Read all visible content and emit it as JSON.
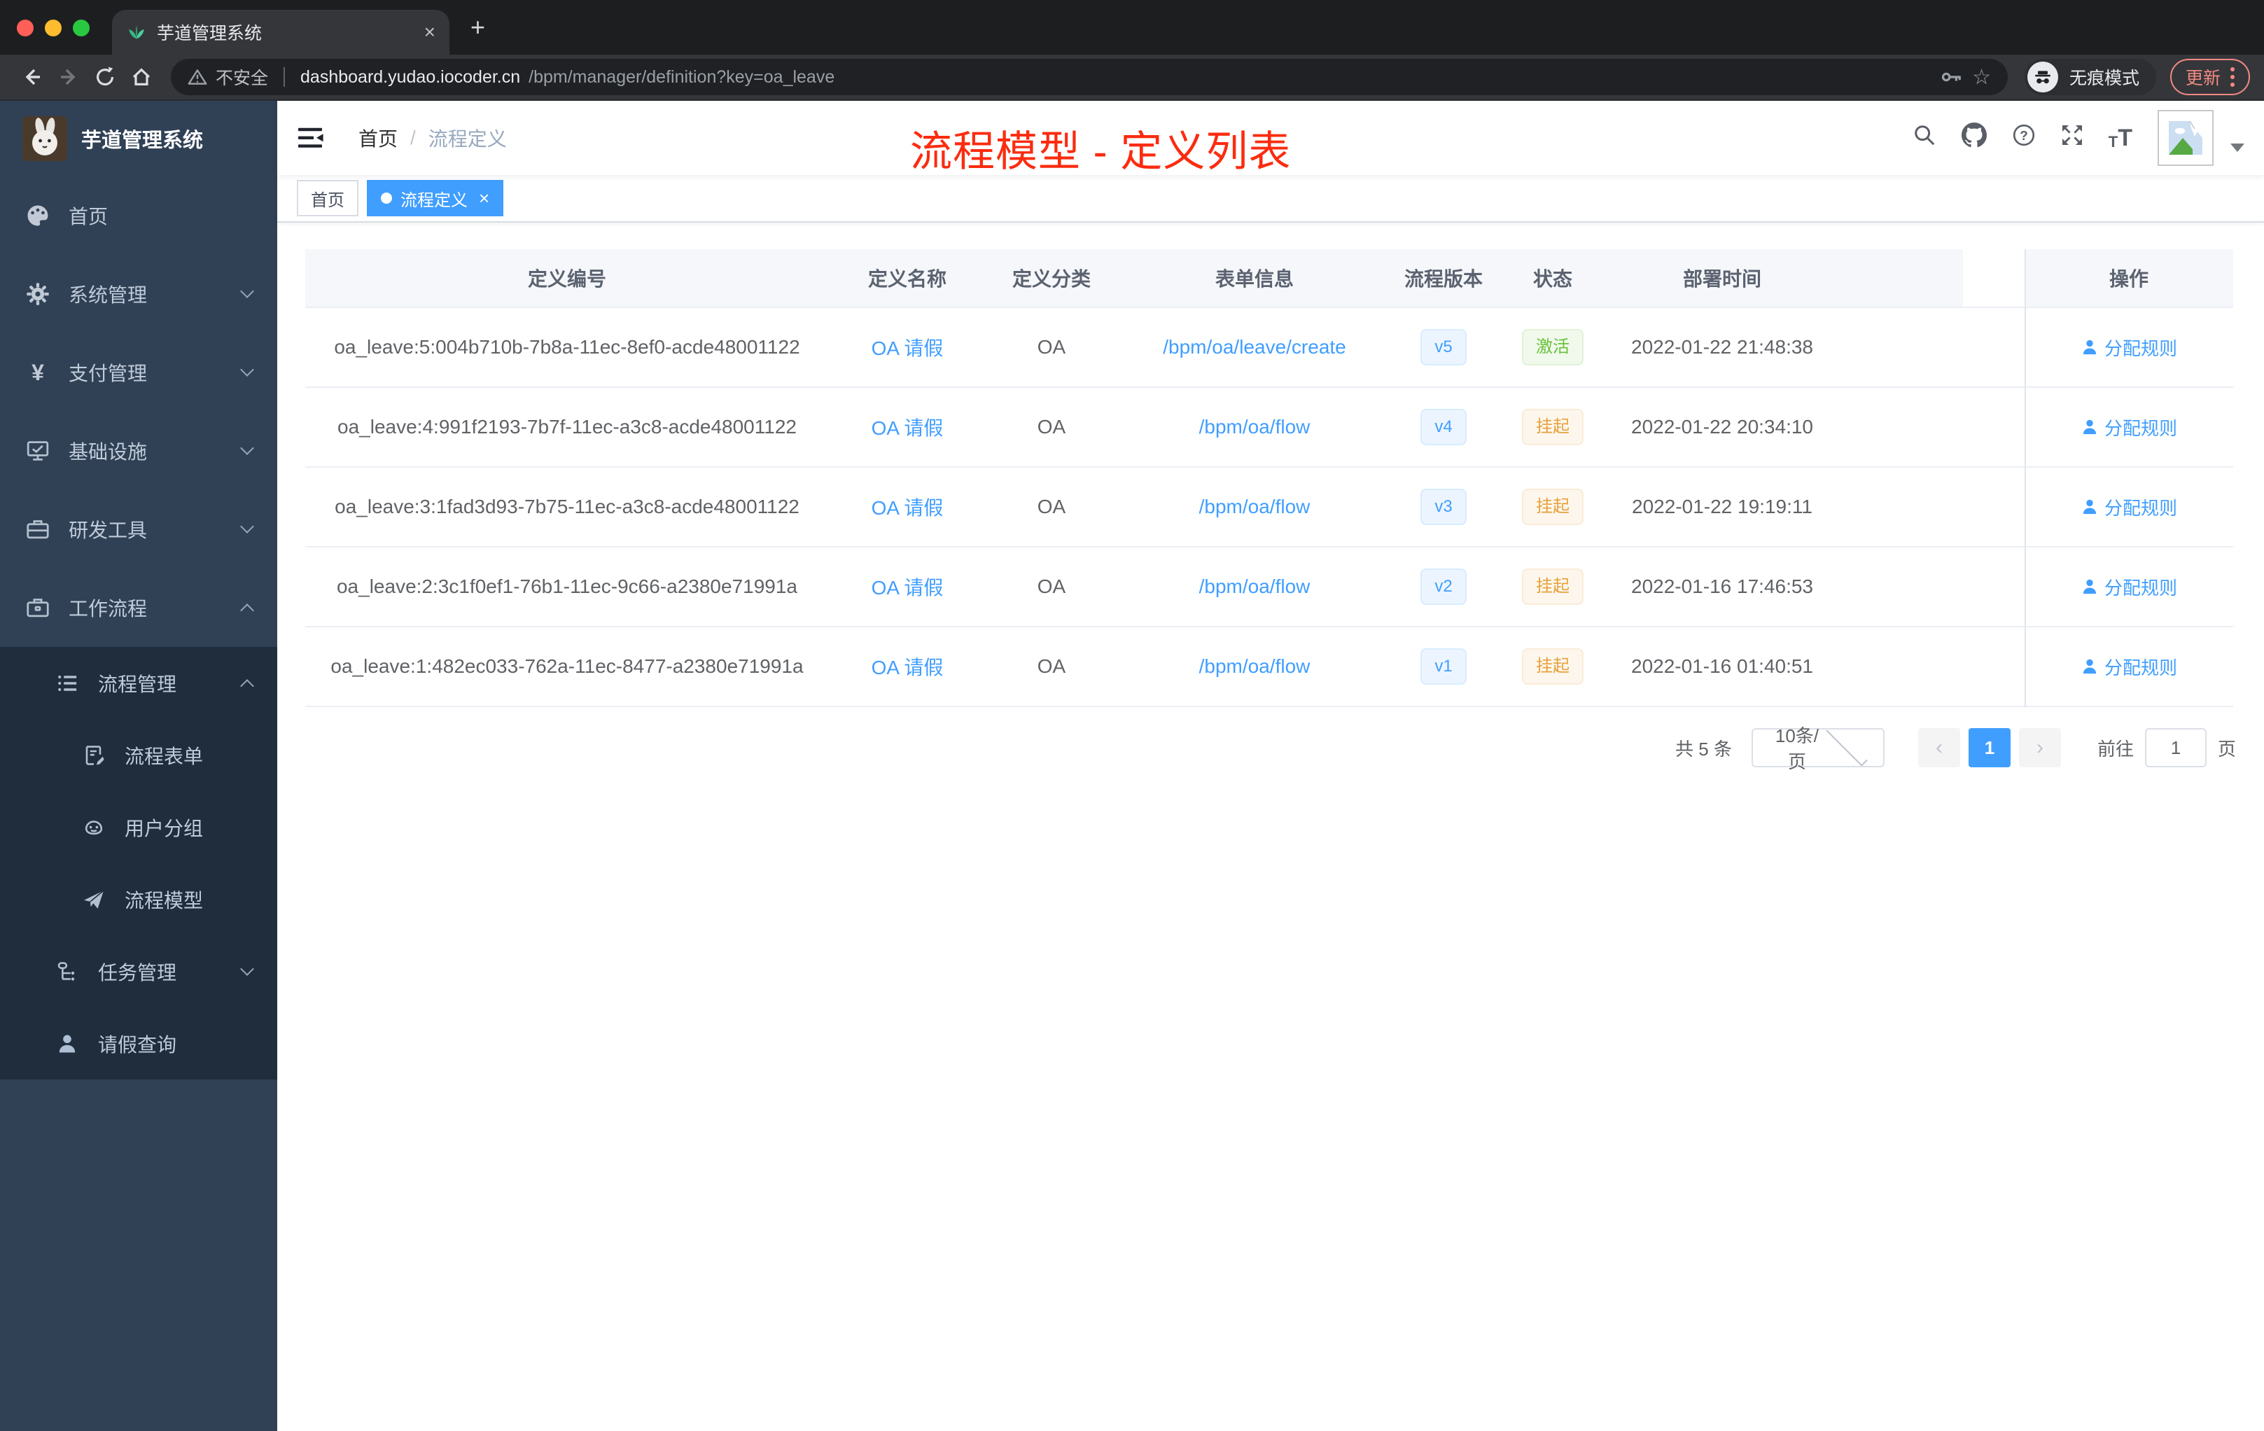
{
  "browser": {
    "tab_title": "芋道管理系统",
    "security_label": "不安全",
    "url_host": "dashboard.yudao.iocoder.cn",
    "url_path": "/bpm/manager/definition?key=oa_leave",
    "incognito_label": "无痕模式",
    "update_label": "更新"
  },
  "glyphs": {
    "close": "×",
    "plus": "+",
    "star": "☆",
    "yen": "¥",
    "question": "?",
    "prev": "‹",
    "next": "›",
    "text_small": "T",
    "text_big": "T"
  },
  "sidebar": {
    "app_title": "芋道管理系统",
    "items": [
      {
        "label": "首页"
      },
      {
        "label": "系统管理"
      },
      {
        "label": "支付管理"
      },
      {
        "label": "基础设施"
      },
      {
        "label": "研发工具"
      },
      {
        "label": "工作流程"
      }
    ],
    "submenu": {
      "process_manage": "流程管理",
      "process_form": "流程表单",
      "user_group": "用户分组",
      "process_model": "流程模型",
      "task_manage": "任务管理",
      "leave_query": "请假查询"
    }
  },
  "header": {
    "breadcrumb_home": "首页",
    "breadcrumb_sep": "/",
    "breadcrumb_current": "流程定义"
  },
  "annotation": {
    "title": "流程模型 - 定义列表",
    "color": "#fb2c10"
  },
  "tags": {
    "home": "首页",
    "active": "流程定义"
  },
  "table": {
    "headers": [
      "定义编号",
      "定义名称",
      "定义分类",
      "表单信息",
      "流程版本",
      "状态",
      "部署时间",
      "操作"
    ],
    "action_label": "分配规则",
    "rows": [
      {
        "id": "oa_leave:5:004b710b-7b8a-11ec-8ef0-acde48001122",
        "name": "OA 请假",
        "category": "OA",
        "form": "/bpm/oa/leave/create",
        "version": "v5",
        "status": "激活",
        "time": "2022-01-22 21:48:38"
      },
      {
        "id": "oa_leave:4:991f2193-7b7f-11ec-a3c8-acde48001122",
        "name": "OA 请假",
        "category": "OA",
        "form": "/bpm/oa/flow",
        "version": "v4",
        "status": "挂起",
        "time": "2022-01-22 20:34:10"
      },
      {
        "id": "oa_leave:3:1fad3d93-7b75-11ec-a3c8-acde48001122",
        "name": "OA 请假",
        "category": "OA",
        "form": "/bpm/oa/flow",
        "version": "v3",
        "status": "挂起",
        "time": "2022-01-22 19:19:11"
      },
      {
        "id": "oa_leave:2:3c1f0ef1-76b1-11ec-9c66-a2380e71991a",
        "name": "OA 请假",
        "category": "OA",
        "form": "/bpm/oa/flow",
        "version": "v2",
        "status": "挂起",
        "time": "2022-01-16 17:46:53"
      },
      {
        "id": "oa_leave:1:482ec033-762a-11ec-8477-a2380e71991a",
        "name": "OA 请假",
        "category": "OA",
        "form": "/bpm/oa/flow",
        "version": "v1",
        "status": "挂起",
        "time": "2022-01-16 01:40:51"
      }
    ]
  },
  "pagination": {
    "total_label": "共 5 条",
    "page_size": "10条/页",
    "current_page": "1",
    "goto_prefix": "前往",
    "goto_value": "1",
    "goto_suffix": "页"
  },
  "colors": {
    "accent_blue": "#409eff",
    "sidebar_bg": "#304156",
    "submenu_bg": "#1f2d3d",
    "annotation_red": "#fb2c10",
    "status_active_green": "#67c23a",
    "status_suspend_orange": "#e6a23c",
    "update_pill_salmon": "#f28b82",
    "table_header_bg": "#f5f7fa"
  }
}
